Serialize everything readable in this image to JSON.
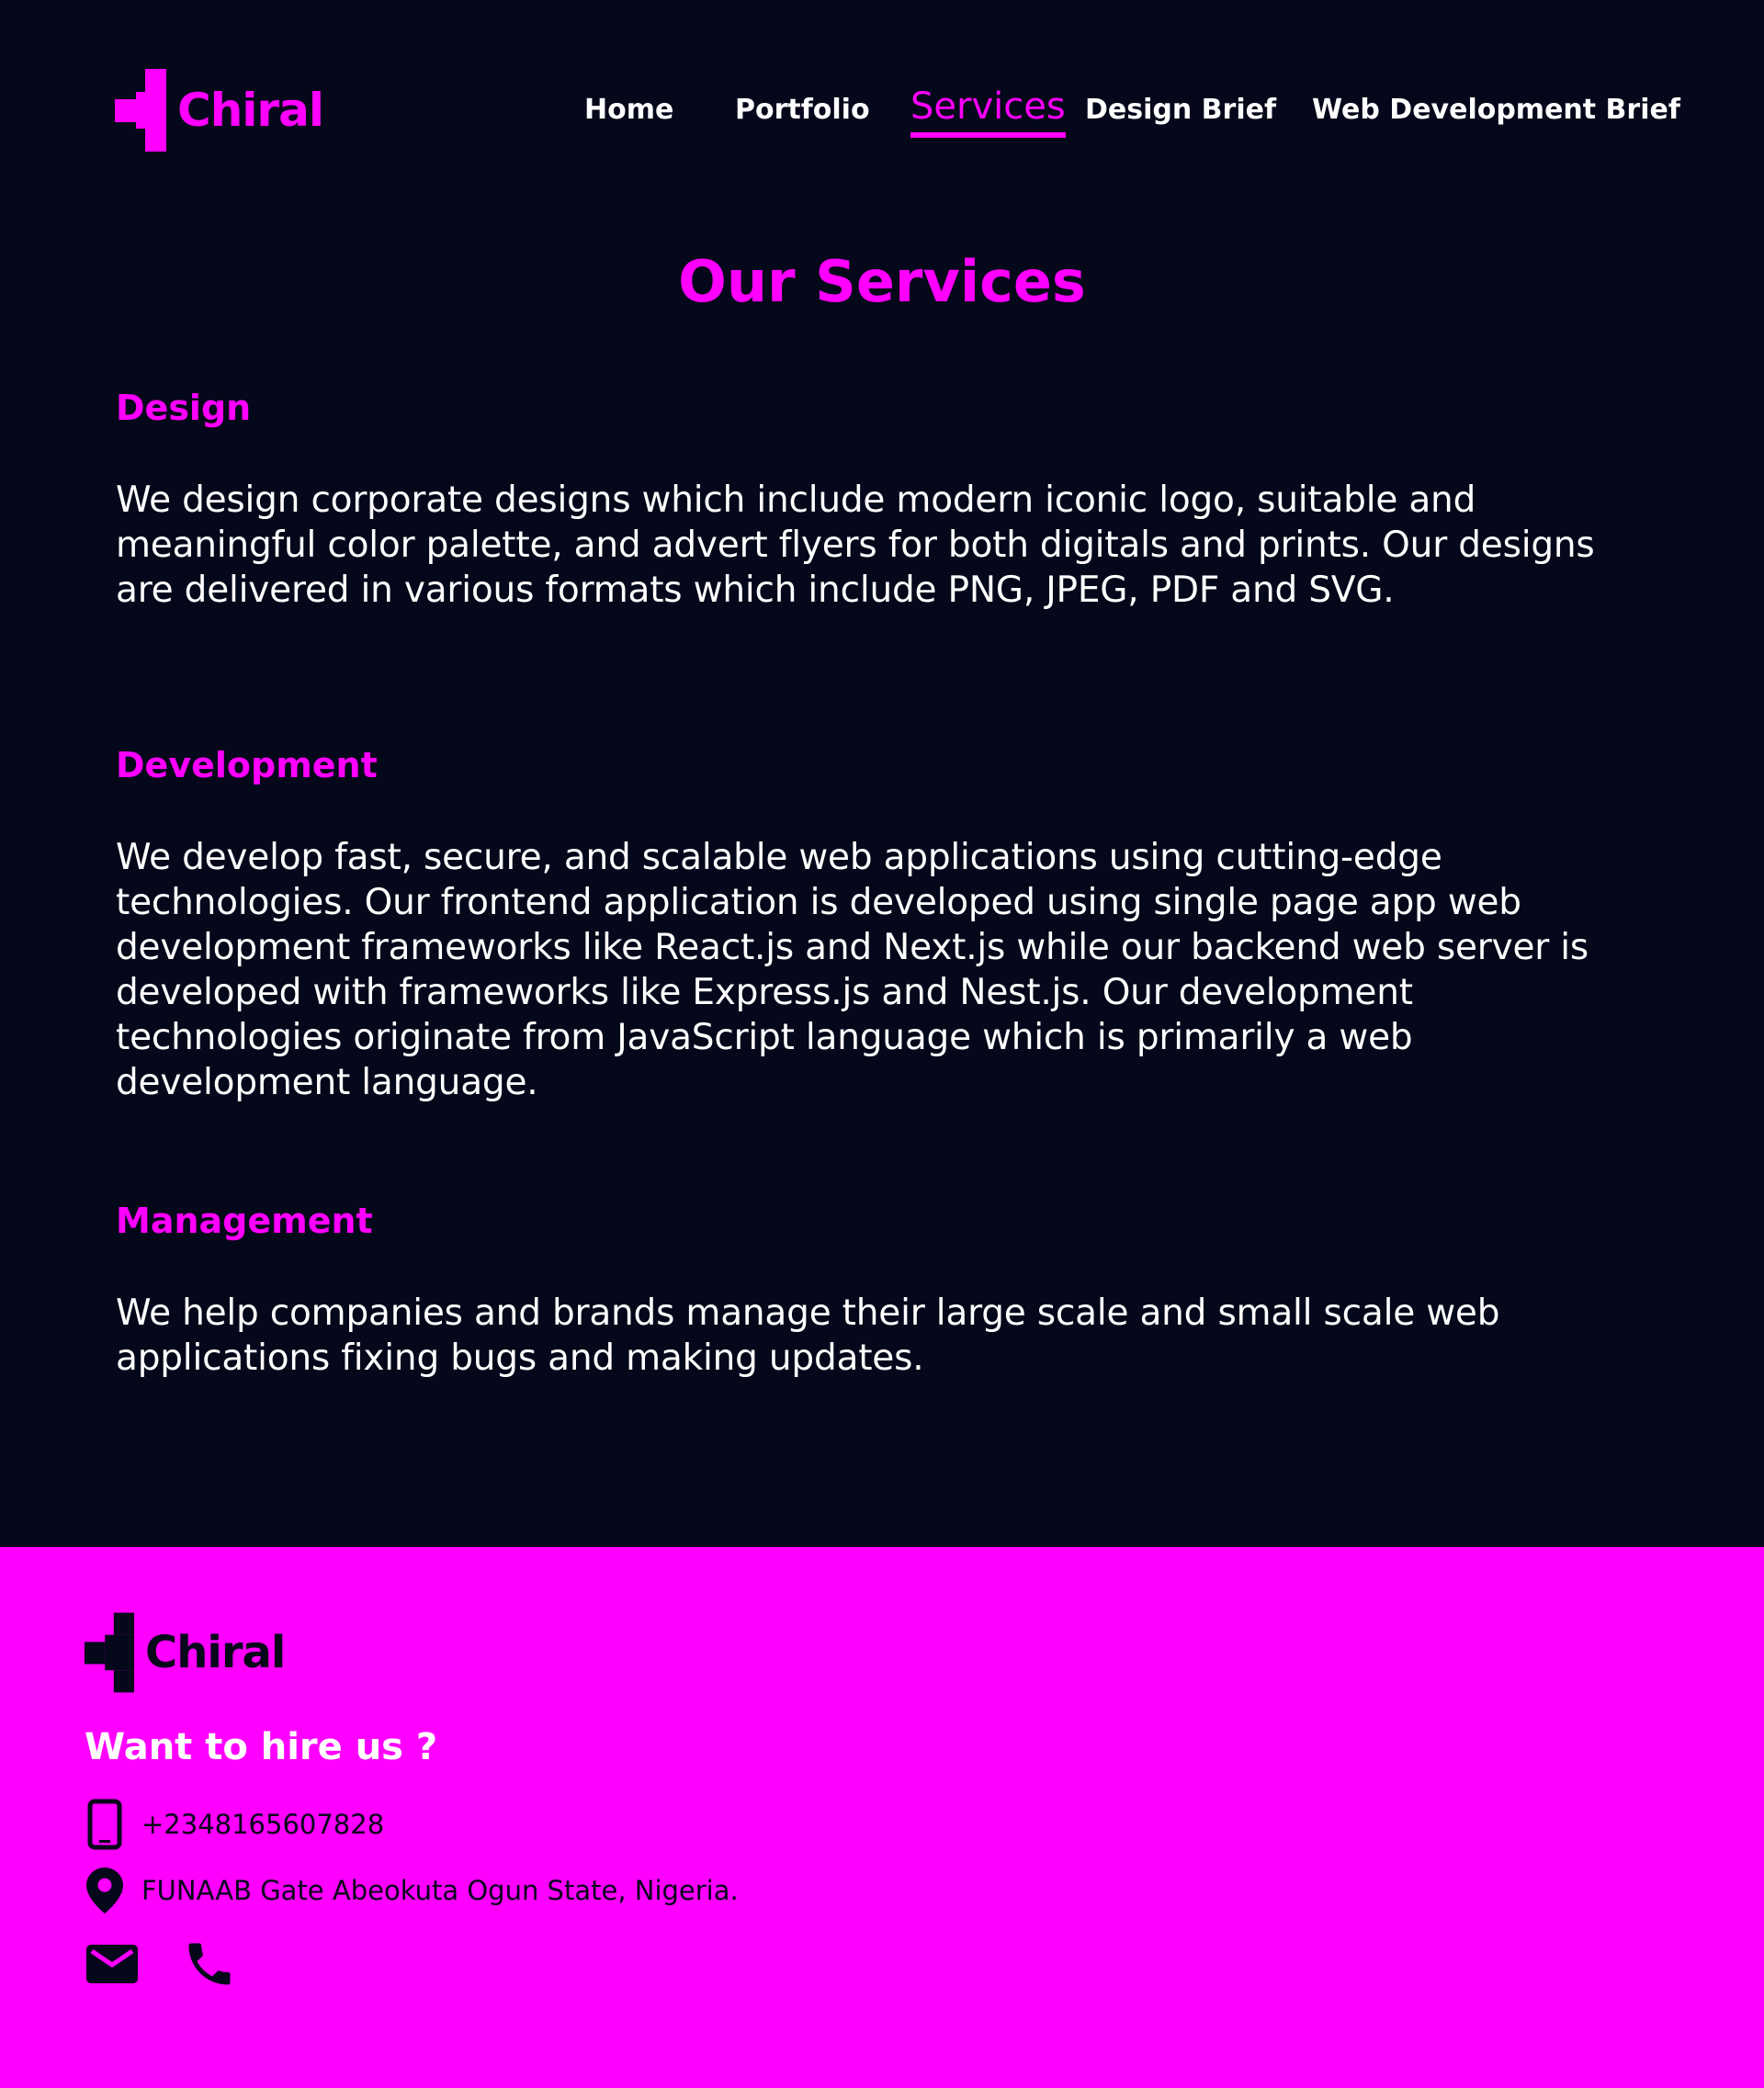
{
  "brand": {
    "name": "Chiral",
    "accent_color": "#ff00ff",
    "background_color": "#05071a"
  },
  "nav": {
    "items": [
      {
        "label": "Home",
        "active": false
      },
      {
        "label": "Portfolio",
        "active": false
      },
      {
        "label": "Services",
        "active": true
      },
      {
        "label": "Design Brief",
        "active": false
      },
      {
        "label": "Web Development Brief",
        "active": false
      }
    ]
  },
  "main": {
    "title": "Our Services",
    "services": [
      {
        "heading": "Design",
        "text": "We design corporate designs which include modern iconic logo, suitable and meaningful color palette, and advert flyers for both digitals and prints. Our designs are delivered in various formats which include PNG, JPEG, PDF and SVG."
      },
      {
        "heading": "Development",
        "text": "We develop fast, secure, and scalable web applications using cutting-edge technologies. Our frontend application is developed using single page app web development frameworks like React.js and Next.js while our backend web server is developed with frameworks like Express.js and Nest.js. Our development technologies originate from JavaScript language which is primarily a web development language."
      },
      {
        "heading": "Management",
        "text": "We help companies and brands manage their large scale and small scale web applications fixing bugs and making updates."
      }
    ]
  },
  "footer": {
    "brand_name": "Chiral",
    "heading": "Want to hire us ?",
    "phone": "+2348165607828",
    "address": "FUNAAB Gate Abeokuta Ogun State, Nigeria.",
    "icons": {
      "phone_row": "smartphone-icon",
      "address_row": "location-pin-icon",
      "social": [
        "email-icon",
        "phone-call-icon"
      ]
    }
  }
}
